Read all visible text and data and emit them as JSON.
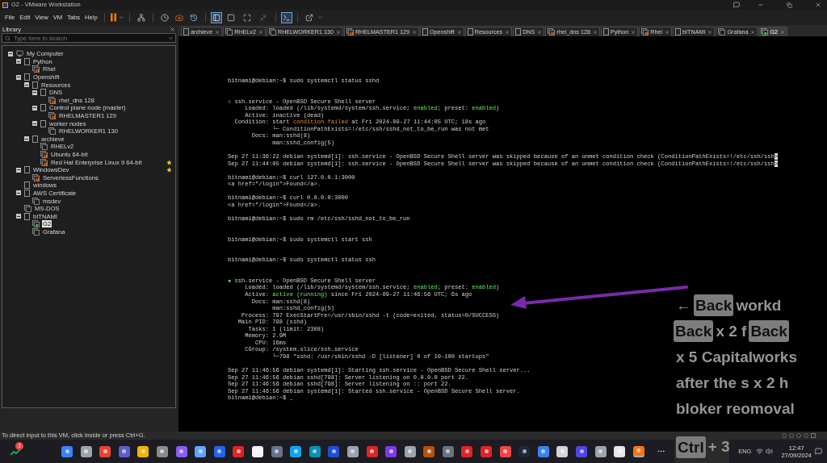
{
  "window": {
    "title": "G2 - VMware Workstation"
  },
  "menu": [
    "File",
    "Edit",
    "View",
    "VM",
    "Tabs",
    "Help"
  ],
  "library": {
    "title": "Library",
    "search": {
      "placeholder": "Type here to search"
    },
    "tree": [
      {
        "kind": "computer",
        "label": "My Computer",
        "expanded": true,
        "selected": false,
        "starred": false,
        "children": [
          {
            "kind": "folder",
            "label": "Python",
            "expanded": true,
            "selected": false,
            "starred": false,
            "children": [
              {
                "kind": "vm",
                "label": "Rhel",
                "suspended": true,
                "running": false,
                "selected": false,
                "starred": false
              }
            ]
          },
          {
            "kind": "folder",
            "label": "Openshift",
            "expanded": true,
            "selected": false,
            "starred": false,
            "children": [
              {
                "kind": "folder",
                "label": "Resources",
                "expanded": true,
                "selected": false,
                "starred": false,
                "children": [
                  {
                    "kind": "folder",
                    "label": "DNS",
                    "expanded": true,
                    "selected": false,
                    "starred": false,
                    "children": [
                      {
                        "kind": "vm",
                        "label": "rhel_dns 128",
                        "suspended": true,
                        "running": false,
                        "selected": false,
                        "starred": false
                      }
                    ]
                  },
                  {
                    "kind": "folder",
                    "label": "Control plane node (master)",
                    "expanded": true,
                    "selected": false,
                    "starred": false,
                    "children": [
                      {
                        "kind": "vm",
                        "label": "RHELMASTER1 129",
                        "suspended": true,
                        "running": false,
                        "selected": false,
                        "starred": false
                      }
                    ]
                  },
                  {
                    "kind": "folder",
                    "label": "worker nodes",
                    "expanded": true,
                    "selected": false,
                    "starred": false,
                    "children": [
                      {
                        "kind": "vm",
                        "label": "RHELWORKER1 130",
                        "suspended": false,
                        "running": false,
                        "selected": false,
                        "starred": false
                      }
                    ]
                  }
                ]
              },
              {
                "kind": "folder",
                "label": "archieve",
                "expanded": true,
                "selected": false,
                "starred": false,
                "children": [
                  {
                    "kind": "vm",
                    "label": "RHELv2",
                    "suspended": false,
                    "running": false,
                    "selected": false,
                    "starred": false
                  },
                  {
                    "kind": "vm",
                    "label": "Ubuntu 64-bit",
                    "suspended": true,
                    "running": false,
                    "selected": false,
                    "starred": false
                  },
                  {
                    "kind": "vm",
                    "label": "Red Hat Enterprise Linux 9 64-bit",
                    "suspended": true,
                    "running": false,
                    "selected": false,
                    "starred": true
                  }
                ]
              }
            ]
          },
          {
            "kind": "folder",
            "label": "WindowsDev",
            "expanded": true,
            "selected": false,
            "starred": true,
            "children": [
              {
                "kind": "vm",
                "label": "ServerlessFunctions",
                "suspended": true,
                "running": false,
                "selected": false,
                "starred": false
              }
            ]
          },
          {
            "kind": "folder",
            "label": "windows",
            "selected": false,
            "starred": false
          },
          {
            "kind": "folder",
            "label": "AWS Certificate",
            "expanded": true,
            "selected": false,
            "starred": false,
            "children": [
              {
                "kind": "vm",
                "label": "msdev",
                "suspended": false,
                "running": false,
                "selected": false,
                "starred": false
              }
            ]
          },
          {
            "kind": "vm",
            "label": "MS-DOS",
            "suspended": false,
            "running": false,
            "selected": false,
            "starred": false
          },
          {
            "kind": "folder",
            "label": "bITNAMI",
            "expanded": true,
            "selected": false,
            "starred": false,
            "children": [
              {
                "kind": "vm",
                "label": "G2",
                "suspended": false,
                "running": true,
                "selected": true,
                "starred": false
              },
              {
                "kind": "vm",
                "label": "Grafana",
                "suspended": false,
                "running": false,
                "selected": false,
                "starred": false
              }
            ]
          }
        ]
      }
    ]
  },
  "tabs": [
    {
      "kind": "folder",
      "label": "archieve",
      "selected": false
    },
    {
      "kind": "vm",
      "label": "RHELv2",
      "suspended": false,
      "running": false,
      "selected": false
    },
    {
      "kind": "vm",
      "label": "RHELWORKER1 130",
      "suspended": false,
      "running": false,
      "selected": false
    },
    {
      "kind": "vm",
      "label": "RHELMASTER1 129",
      "suspended": true,
      "running": false,
      "selected": false
    },
    {
      "kind": "folder",
      "label": "Openshift",
      "selected": false
    },
    {
      "kind": "folder",
      "label": "Resources",
      "selected": false
    },
    {
      "kind": "folder",
      "label": "DNS",
      "selected": false
    },
    {
      "kind": "vm",
      "label": "rhel_dns 128",
      "suspended": true,
      "running": false,
      "selected": false
    },
    {
      "kind": "folder",
      "label": "Python",
      "selected": false
    },
    {
      "kind": "vm",
      "label": "Rhel",
      "suspended": true,
      "running": false,
      "selected": false
    },
    {
      "kind": "folder",
      "label": "bITNAMI",
      "selected": false
    },
    {
      "kind": "vm",
      "label": "Grafana",
      "suspended": false,
      "running": false,
      "selected": false
    },
    {
      "kind": "vm",
      "label": "G2",
      "suspended": false,
      "running": true,
      "selected": true
    }
  ],
  "terminal": {
    "lines": [
      {
        "kind": "text",
        "segments": [
          {
            "kind": "plain",
            "text": "bitnami@debian:~$ sudo systemctl status sshd"
          }
        ]
      },
      {
        "kind": "blank"
      },
      {
        "kind": "blank"
      },
      {
        "kind": "text",
        "segments": [
          {
            "kind": "plain",
            "text": "○ ssh.service - OpenBSD Secure Shell server"
          }
        ]
      },
      {
        "kind": "text",
        "segments": [
          {
            "kind": "plain",
            "text": "     Loaded: loaded (/lib/systemd/system/ssh.service; "
          },
          {
            "kind": "ok",
            "text": "enabled"
          },
          {
            "kind": "plain",
            "text": "; preset: "
          },
          {
            "kind": "ok",
            "text": "enabled"
          },
          {
            "kind": "plain",
            "text": ")"
          }
        ]
      },
      {
        "kind": "text",
        "segments": [
          {
            "kind": "plain",
            "text": "     Active: inactive (dead)"
          }
        ]
      },
      {
        "kind": "text",
        "segments": [
          {
            "kind": "plain",
            "text": "  Condition: start "
          },
          {
            "kind": "warn",
            "text": "condition failed"
          },
          {
            "kind": "plain",
            "text": " at Fri 2024-09-27 11:44:05 UTC; 18s ago"
          }
        ]
      },
      {
        "kind": "text",
        "segments": [
          {
            "kind": "plain",
            "text": "             └─ ConditionPathExists=!/etc/ssh/sshd_not_to_be_run was not met"
          }
        ]
      },
      {
        "kind": "text",
        "segments": [
          {
            "kind": "plain",
            "text": "       Docs: man:sshd(8)"
          }
        ]
      },
      {
        "kind": "text",
        "segments": [
          {
            "kind": "plain",
            "text": "             man:sshd_config(5)"
          }
        ]
      },
      {
        "kind": "blank"
      },
      {
        "kind": "text",
        "segments": [
          {
            "kind": "plain",
            "text": "Sep 27 11:36:22 debian systemd[1]: ssh.service - OpenBSD Secure Shell server was skipped because of an unmet condition check (ConditionPathExists=!/etc/ssh/ssh"
          },
          {
            "kind": "marker",
            "text": ">"
          }
        ]
      },
      {
        "kind": "text",
        "segments": [
          {
            "kind": "plain",
            "text": "Sep 27 11:44:05 debian systemd[1]: ssh.service - OpenBSD Secure Shell server was skipped because of an unmet condition check (ConditionPathExists=!/etc/ssh/ssh"
          },
          {
            "kind": "marker",
            "text": ">"
          }
        ]
      },
      {
        "kind": "blank"
      },
      {
        "kind": "text",
        "segments": [
          {
            "kind": "plain",
            "text": "bitnami@debian:~$ curl 127.0.0.1:3000"
          }
        ]
      },
      {
        "kind": "text",
        "segments": [
          {
            "kind": "plain",
            "text": "<a href=\"/login\">Found</a>."
          }
        ]
      },
      {
        "kind": "blank"
      },
      {
        "kind": "text",
        "segments": [
          {
            "kind": "plain",
            "text": "bitnami@debian:~$ curl 0.0.0.0:3000"
          }
        ]
      },
      {
        "kind": "text",
        "segments": [
          {
            "kind": "plain",
            "text": "<a href=\"/login\">Found</a>."
          }
        ]
      },
      {
        "kind": "blank"
      },
      {
        "kind": "text",
        "segments": [
          {
            "kind": "plain",
            "text": "bitnami@debian:~$ sudo rm /etc/ssh/sshd_not_to_be_run"
          }
        ]
      },
      {
        "kind": "blank"
      },
      {
        "kind": "blank"
      },
      {
        "kind": "text",
        "segments": [
          {
            "kind": "plain",
            "text": "bitnami@debian:~$ sudo systemctl start ssh"
          }
        ]
      },
      {
        "kind": "blank"
      },
      {
        "kind": "blank"
      },
      {
        "kind": "text",
        "segments": [
          {
            "kind": "plain",
            "text": "bitnami@debian:~$ sudo systemctl status ssh"
          }
        ]
      },
      {
        "kind": "blank"
      },
      {
        "kind": "blank"
      },
      {
        "kind": "text",
        "segments": [
          {
            "kind": "ok",
            "text": "●"
          },
          {
            "kind": "plain",
            "text": " ssh.service - OpenBSD Secure Shell server"
          }
        ]
      },
      {
        "kind": "text",
        "segments": [
          {
            "kind": "plain",
            "text": "     Loaded: loaded (/lib/systemd/system/ssh.service; "
          },
          {
            "kind": "ok",
            "text": "enabled"
          },
          {
            "kind": "plain",
            "text": "; preset: "
          },
          {
            "kind": "ok",
            "text": "enabled"
          },
          {
            "kind": "plain",
            "text": ")"
          }
        ]
      },
      {
        "kind": "text",
        "segments": [
          {
            "kind": "plain",
            "text": "     Active: "
          },
          {
            "kind": "ok",
            "text": "active (running)"
          },
          {
            "kind": "plain",
            "text": " since Fri 2024-09-27 11:46:56 UTC; 6s ago"
          }
        ]
      },
      {
        "kind": "text",
        "segments": [
          {
            "kind": "plain",
            "text": "       Docs: man:sshd(8)"
          }
        ]
      },
      {
        "kind": "text",
        "segments": [
          {
            "kind": "plain",
            "text": "             man:sshd_config(5)"
          }
        ]
      },
      {
        "kind": "text",
        "segments": [
          {
            "kind": "plain",
            "text": "    Process: 797 ExecStartPre=/usr/sbin/sshd -t (code=exited, status=0/SUCCESS)"
          }
        ]
      },
      {
        "kind": "text",
        "segments": [
          {
            "kind": "plain",
            "text": "   Main PID: 798 (sshd)"
          }
        ]
      },
      {
        "kind": "text",
        "segments": [
          {
            "kind": "plain",
            "text": "      Tasks: 1 (limit: 2308)"
          }
        ]
      },
      {
        "kind": "text",
        "segments": [
          {
            "kind": "plain",
            "text": "     Memory: 2.9M"
          }
        ]
      },
      {
        "kind": "text",
        "segments": [
          {
            "kind": "plain",
            "text": "        CPU: 16ms"
          }
        ]
      },
      {
        "kind": "text",
        "segments": [
          {
            "kind": "plain",
            "text": "     CGroup: /system.slice/ssh.service"
          }
        ]
      },
      {
        "kind": "text",
        "segments": [
          {
            "kind": "plain",
            "text": "             └─798 \"sshd: /usr/sbin/sshd -D [listener] 0 of 10-100 startups\""
          }
        ]
      },
      {
        "kind": "blank"
      },
      {
        "kind": "text",
        "segments": [
          {
            "kind": "plain",
            "text": "Sep 27 11:46:56 debian systemd[1]: Starting ssh.service - OpenBSD Secure Shell server..."
          }
        ]
      },
      {
        "kind": "text",
        "segments": [
          {
            "kind": "plain",
            "text": "Sep 27 11:46:56 debian sshd[798]: Server listening on 0.0.0.0 port 22."
          }
        ]
      },
      {
        "kind": "text",
        "segments": [
          {
            "kind": "plain",
            "text": "Sep 27 11:46:56 debian sshd[798]: Server listening on :: port 22."
          }
        ]
      },
      {
        "kind": "text",
        "segments": [
          {
            "kind": "plain",
            "text": "Sep 27 11:46:56 debian systemd[1]: Started ssh.service - OpenBSD Secure Shell server."
          }
        ]
      },
      {
        "kind": "text",
        "segments": [
          {
            "kind": "plain",
            "text": "bitnami@debian:~$ _"
          }
        ]
      }
    ]
  },
  "status_bar": "To direct input to this VM, click inside or press Ctrl+G.",
  "key_overlay": {
    "lines": [
      [
        {
          "kind": "text",
          "text": "←"
        },
        {
          "kind": "key",
          "text": "Back"
        },
        {
          "kind": "text",
          "text": "workd"
        }
      ],
      [
        {
          "kind": "key",
          "text": "Back"
        },
        {
          "kind": "text",
          "text": "x 2 f"
        },
        {
          "kind": "key",
          "text": "Back"
        }
      ],
      [
        {
          "kind": "text",
          "text": "x 5 Capitalworks"
        }
      ],
      [
        {
          "kind": "text",
          "text": "after the s x 2 h"
        }
      ],
      [
        {
          "kind": "text",
          "text": "bloker reomoval"
        }
      ]
    ],
    "shortcut": [
      {
        "kind": "key",
        "text": "Ctrl"
      },
      {
        "kind": "text",
        "text": "+ 3"
      }
    ]
  },
  "taskbar": {
    "widget_badge": "1",
    "language": "ENG",
    "time": "12:47",
    "date": "27/09/2024"
  }
}
